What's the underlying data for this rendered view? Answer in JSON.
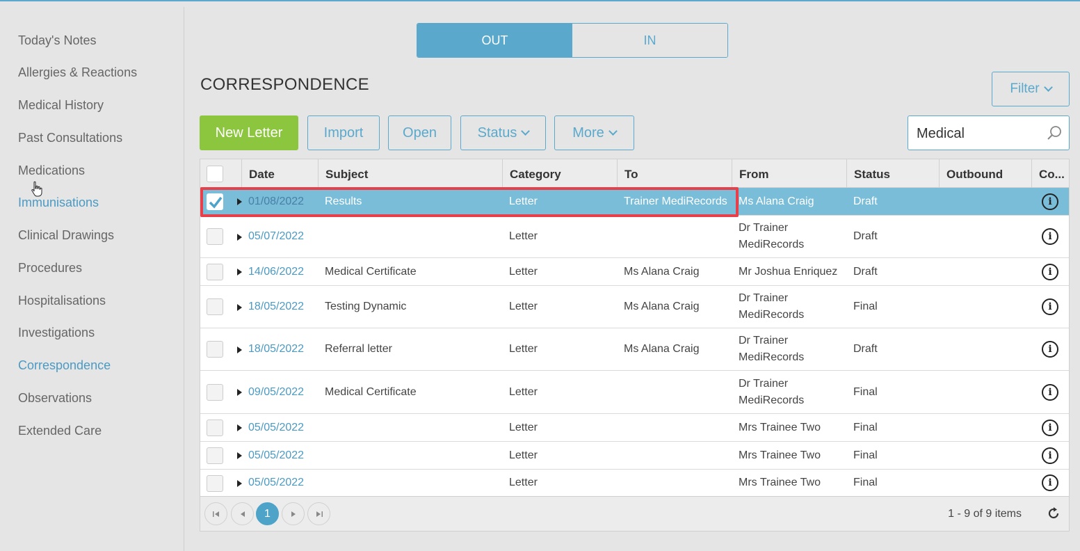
{
  "sidebar": {
    "items": [
      {
        "label": "Today's Notes",
        "active": false
      },
      {
        "label": "Allergies & Reactions",
        "active": false
      },
      {
        "label": "Medical History",
        "active": false
      },
      {
        "label": "Past Consultations",
        "active": false
      },
      {
        "label": "Medications",
        "active": false
      },
      {
        "label": "Immunisations",
        "active": true
      },
      {
        "label": "Clinical Drawings",
        "active": false
      },
      {
        "label": "Procedures",
        "active": false
      },
      {
        "label": "Hospitalisations",
        "active": false
      },
      {
        "label": "Investigations",
        "active": false
      },
      {
        "label": "Correspondence",
        "active": true
      },
      {
        "label": "Observations",
        "active": false
      },
      {
        "label": "Extended Care",
        "active": false
      }
    ]
  },
  "toggle": {
    "out_label": "OUT",
    "in_label": "IN",
    "selected": "OUT"
  },
  "page_title": "CORRESPONDENCE",
  "toolbar": {
    "new_letter": "New Letter",
    "import": "Import",
    "open": "Open",
    "status": "Status",
    "more": "More",
    "filter": "Filter"
  },
  "search": {
    "value": "Medical"
  },
  "table": {
    "columns": [
      "Date",
      "Subject",
      "Category",
      "To",
      "From",
      "Status",
      "Outbound",
      "Co..."
    ],
    "rows": [
      {
        "date": "01/08/2022",
        "subject": "Results",
        "category": "Letter",
        "to": "Trainer MediRecords",
        "from": "Ms Alana Craig",
        "status": "Draft",
        "outbound": "",
        "checked": true,
        "selected": true
      },
      {
        "date": "05/07/2022",
        "subject": "",
        "category": "Letter",
        "to": "",
        "from": "Dr Trainer MediRecords",
        "status": "Draft",
        "outbound": "",
        "checked": false,
        "selected": false
      },
      {
        "date": "14/06/2022",
        "subject": "Medical Certificate",
        "category": "Letter",
        "to": "Ms Alana Craig",
        "from": "Mr Joshua Enriquez",
        "status": "Draft",
        "outbound": "",
        "checked": false,
        "selected": false
      },
      {
        "date": "18/05/2022",
        "subject": "Testing Dynamic",
        "category": "Letter",
        "to": "Ms Alana Craig",
        "from": "Dr Trainer MediRecords",
        "status": "Final",
        "outbound": "",
        "checked": false,
        "selected": false
      },
      {
        "date": "18/05/2022",
        "subject": "Referral letter",
        "category": "Letter",
        "to": "Ms Alana Craig",
        "from": "Dr Trainer MediRecords",
        "status": "Draft",
        "outbound": "",
        "checked": false,
        "selected": false
      },
      {
        "date": "09/05/2022",
        "subject": "Medical Certificate",
        "category": "Letter",
        "to": "",
        "from": "Dr Trainer MediRecords",
        "status": "Final",
        "outbound": "",
        "checked": false,
        "selected": false
      },
      {
        "date": "05/05/2022",
        "subject": "",
        "category": "Letter",
        "to": "",
        "from": "Mrs Trainee Two",
        "status": "Final",
        "outbound": "",
        "checked": false,
        "selected": false
      },
      {
        "date": "05/05/2022",
        "subject": "",
        "category": "Letter",
        "to": "",
        "from": "Mrs Trainee Two",
        "status": "Final",
        "outbound": "",
        "checked": false,
        "selected": false
      },
      {
        "date": "05/05/2022",
        "subject": "",
        "category": "Letter",
        "to": "",
        "from": "Mrs Trainee Two",
        "status": "Final",
        "outbound": "",
        "checked": false,
        "selected": false
      }
    ]
  },
  "pager": {
    "current_page": "1",
    "summary": "1 - 9 of 9 items"
  },
  "colors": {
    "accent": "#5aa9cc",
    "primary_button": "#8cc63f",
    "selected_row": "#79bdd9",
    "highlight": "#e8404a"
  }
}
